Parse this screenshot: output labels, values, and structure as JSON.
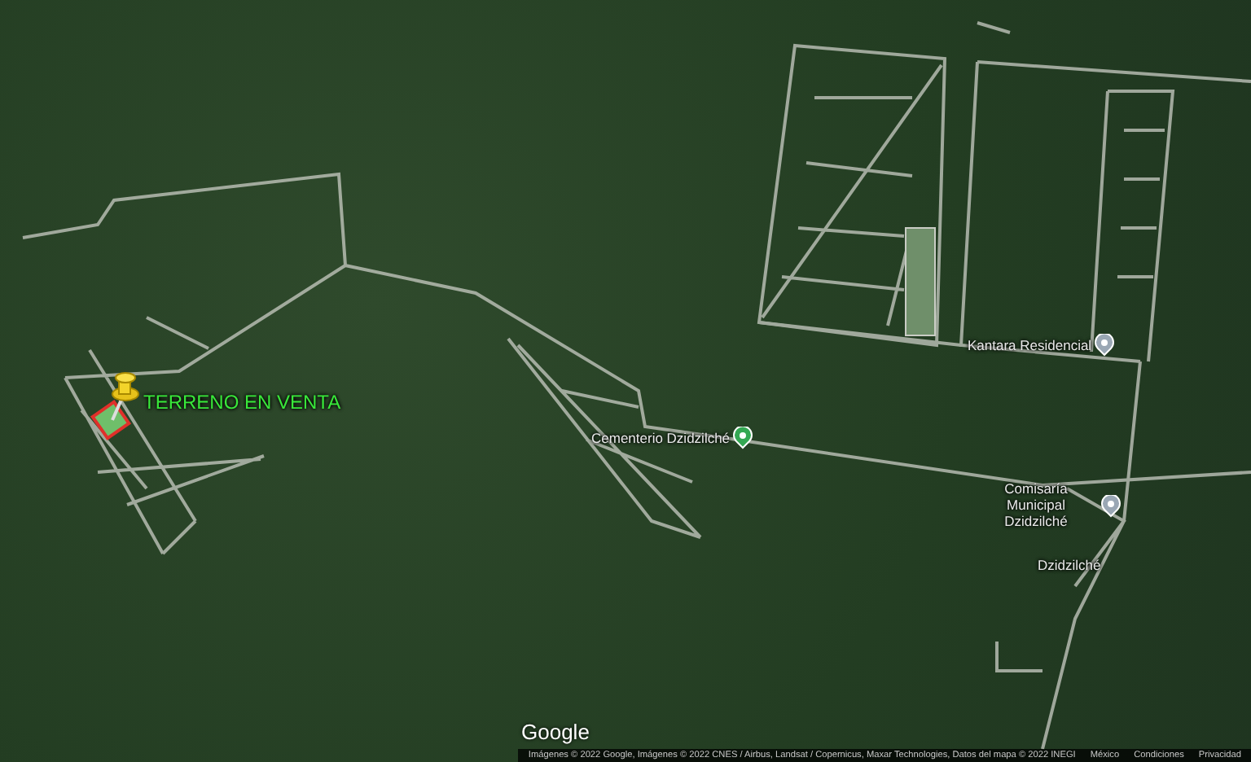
{
  "map": {
    "labels": [
      {
        "kind": "custom",
        "text": "TERRENO EN VENTA"
      },
      {
        "kind": "poi",
        "text": "Cementerio Dzidzilché",
        "color": "#34a853"
      },
      {
        "kind": "poi",
        "text": "Kantara Residencial",
        "color": "#9aa7b4"
      },
      {
        "kind": "poi",
        "text": "Comisaría Municipal Dzidzilché",
        "color": "#9aa7b4"
      },
      {
        "kind": "place",
        "text": "Dzidzilché"
      }
    ]
  },
  "logo": "Google",
  "attribution": [
    "Imágenes © 2022 Google, Imágenes © 2022 CNES / Airbus, Landsat / Copernicus, Maxar Technologies, Datos del mapa © 2022 INEGI",
    "México",
    "Condiciones",
    "Privacidad"
  ]
}
